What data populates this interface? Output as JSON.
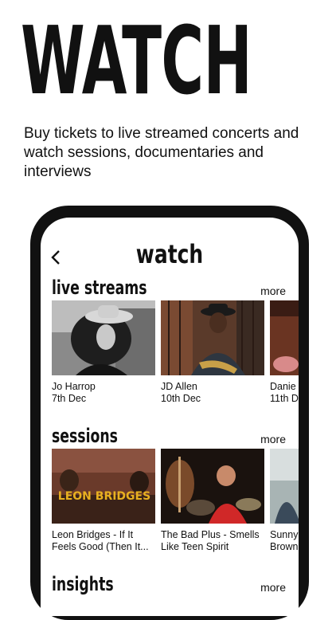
{
  "hero": {
    "title": "WATCH",
    "tagline": "Buy tickets to live streamed concerts and watch sessions, documentaries and interviews"
  },
  "screen": {
    "title": "watch",
    "back_icon": "chevron-left-icon"
  },
  "sections": [
    {
      "title": "live streams",
      "more_label": "more",
      "items": [
        {
          "line1": "Jo Harrop",
          "line2": "7th Dec"
        },
        {
          "line1": "JD Allen",
          "line2": "10th Dec"
        },
        {
          "line1": "Danie",
          "line2": "11th D"
        }
      ]
    },
    {
      "title": "sessions",
      "more_label": "more",
      "items": [
        {
          "line1": "Leon Bridges - If It",
          "line2": "Feels Good (Then It..."
        },
        {
          "line1": "The Bad Plus - Smells",
          "line2": "Like Teen Spirit"
        },
        {
          "line1": "Sunny",
          "line2": "Brown"
        }
      ]
    },
    {
      "title": "insights",
      "more_label": "more",
      "items": []
    }
  ],
  "thumb_texts": {
    "leon_bridges": "LEON BRIDGES"
  }
}
